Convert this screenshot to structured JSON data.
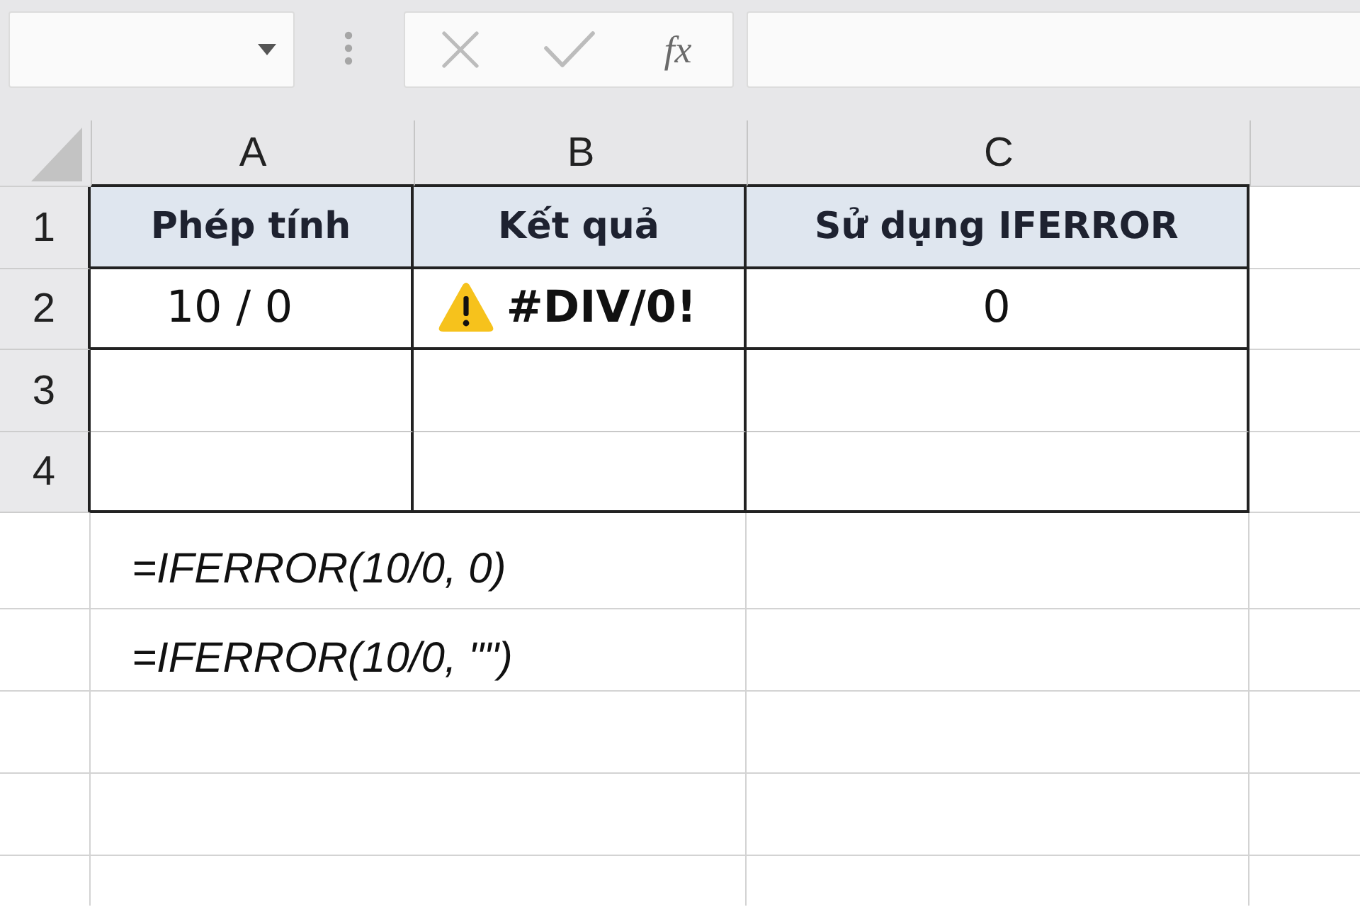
{
  "formula_bar": {
    "function_label": "fx"
  },
  "sheet": {
    "columns": [
      "A",
      "B",
      "C"
    ],
    "rows": [
      {
        "number": "1",
        "cells": [
          {
            "kind": "header",
            "text": "Phép tính"
          },
          {
            "kind": "header",
            "text": "Kết quả"
          },
          {
            "kind": "header",
            "text": "Sử dụng IFERROR"
          }
        ]
      },
      {
        "number": "2",
        "cells": [
          {
            "kind": "value",
            "text": "10 / 0"
          },
          {
            "kind": "error",
            "text": "#DIV/0!"
          },
          {
            "kind": "value",
            "text": "0"
          }
        ]
      },
      {
        "number": "3"
      },
      {
        "number": "4"
      }
    ],
    "formulas": [
      "=IFERROR(10/0, 0)",
      "=IFERROR(10/0, \"\")"
    ]
  }
}
